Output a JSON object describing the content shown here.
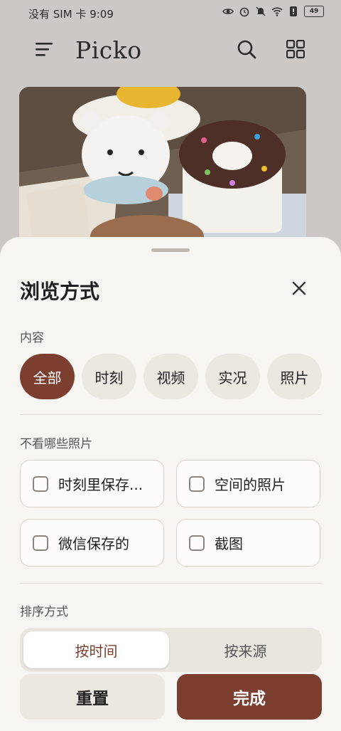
{
  "status": {
    "carrier_time": "没有 SIM 卡 9:09",
    "battery": "49"
  },
  "app": {
    "title": "Picko",
    "icons": [
      "menu-icon",
      "search-icon",
      "grid-icon"
    ]
  },
  "sheet": {
    "title": "浏览方式",
    "content_section": {
      "label": "内容",
      "chips": [
        "全部",
        "时刻",
        "视频",
        "实况",
        "照片"
      ],
      "selected": "全部"
    },
    "exclude_section": {
      "label": "不看哪些照片",
      "options": [
        "时刻里保存...",
        "空间的照片",
        "微信保存的",
        "截图"
      ]
    },
    "sort_section": {
      "label": "排序方式",
      "options": [
        "按时间",
        "按来源"
      ],
      "selected": "按时间"
    },
    "reset_label": "重置",
    "done_label": "完成"
  },
  "colors": {
    "accent": "#7c3f2f",
    "sheet_bg": "#f7f5f1",
    "chip_bg": "#ebe7e1"
  }
}
